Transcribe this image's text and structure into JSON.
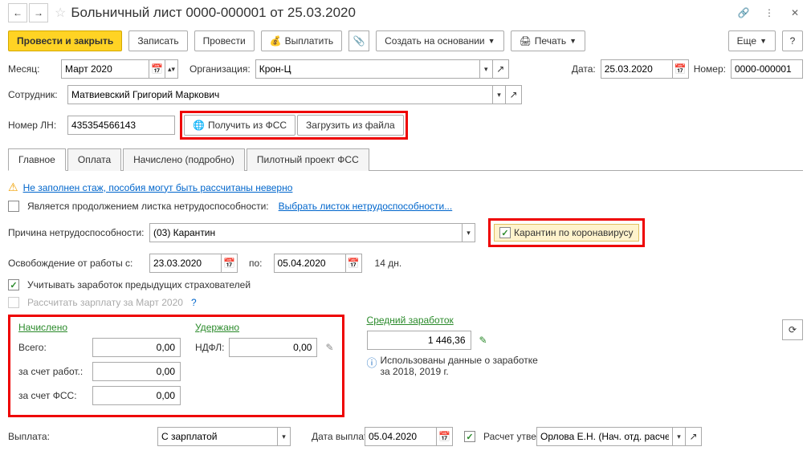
{
  "title": "Больничный лист 0000-000001 от 25.03.2020",
  "toolbar": {
    "post_close": "Провести и закрыть",
    "save": "Записать",
    "post": "Провести",
    "pay": "Выплатить",
    "create_base": "Создать на основании",
    "print": "Печать",
    "more": "Еще"
  },
  "form": {
    "month_label": "Месяц:",
    "month_value": "Март 2020",
    "org_label": "Организация:",
    "org_value": "Крон-Ц",
    "date_label": "Дата:",
    "date_value": "25.03.2020",
    "number_label": "Номер:",
    "number_value": "0000-000001",
    "employee_label": "Сотрудник:",
    "employee_value": "Матвиевский Григорий Маркович",
    "ln_label": "Номер ЛН:",
    "ln_value": "435354566143",
    "get_fss": "Получить из ФСС",
    "load_file": "Загрузить из файла"
  },
  "tabs": {
    "main": "Главное",
    "payment": "Оплата",
    "accrued": "Начислено (подробно)",
    "pilot": "Пилотный проект ФСС"
  },
  "main_tab": {
    "warning": "Не заполнен стаж, пособия могут быть рассчитаны неверно",
    "continuation_label": "Является продолжением листка нетрудоспособности:",
    "continuation_link": "Выбрать листок нетрудоспособности...",
    "reason_label": "Причина нетрудоспособности:",
    "reason_value": "(03) Карантин",
    "covid_label": "Карантин по коронавирусу",
    "release_label": "Освобождение от работы с:",
    "release_from": "23.03.2020",
    "release_to_label": "по:",
    "release_to": "05.04.2020",
    "days": "14 дн.",
    "prev_earn": "Учитывать заработок предыдущих страхователей",
    "recalc": "Рассчитать зарплату за Март 2020",
    "accrued_header": "Начислено",
    "withheld_header": "Удержано",
    "total_label": "Всего:",
    "total_value": "0,00",
    "employer_label": "за счет работ.:",
    "employer_value": "0,00",
    "fss_label": "за счет ФСС:",
    "fss_value": "0,00",
    "ndfl_label": "НДФЛ:",
    "ndfl_value": "0,00",
    "avg_header": "Средний заработок",
    "avg_value": "1 446,36",
    "info_text": "Использованы данные о заработке за 2018,   2019 г.",
    "payout_label": "Выплата:",
    "payout_value": "С зарплатой",
    "payout_date_label": "Дата выплаты:",
    "payout_date": "05.04.2020",
    "approved_label": "Расчет утвердил",
    "approver": "Орлова Е.Н. (Нач. отд. расчет..."
  }
}
